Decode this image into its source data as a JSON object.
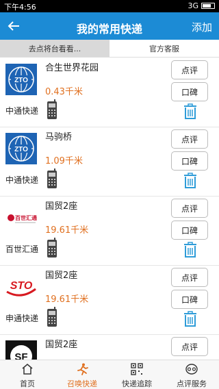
{
  "statusbar": {
    "time": "下午4:56",
    "network": "3G"
  },
  "header": {
    "title": "我的常用快递",
    "add_label": "添加"
  },
  "tabs": [
    {
      "label": "去点将台看看...",
      "active": true
    },
    {
      "label": "官方客服",
      "active": false
    }
  ],
  "rows": [
    {
      "company": "中通快递",
      "logo": "zto",
      "place": "合生世界花园",
      "distance": "0.43千米",
      "review": "点评",
      "koubei": "口碑"
    },
    {
      "company": "中通快递",
      "logo": "zto",
      "place": "马驹桥",
      "distance": "1.09千米",
      "review": "点评",
      "koubei": "口碑"
    },
    {
      "company": "百世汇通",
      "logo": "best",
      "logo_text": "百世汇通",
      "place": "国贸2座",
      "distance": "19.61千米",
      "review": "点评",
      "koubei": "口碑"
    },
    {
      "company": "申通快递",
      "logo": "sto",
      "logo_text": "STO",
      "place": "国贸2座",
      "distance": "19.61千米",
      "review": "点评",
      "koubei": "口碑"
    },
    {
      "company": "",
      "logo": "sf",
      "logo_text": "SF",
      "place": "国贸2座",
      "distance": "",
      "review": "点评",
      "koubei": ""
    }
  ],
  "tabbar": [
    {
      "label": "首页",
      "icon": "home-icon",
      "active": false
    },
    {
      "label": "召唤快递",
      "icon": "runner-icon",
      "active": true
    },
    {
      "label": "快递追踪",
      "icon": "qrcode-icon",
      "active": false
    },
    {
      "label": "点评服务",
      "icon": "review-icon",
      "active": false
    }
  ],
  "colors": {
    "header": "#1C8BD5",
    "accent": "#E07020",
    "trash": "#2E9CD8"
  }
}
